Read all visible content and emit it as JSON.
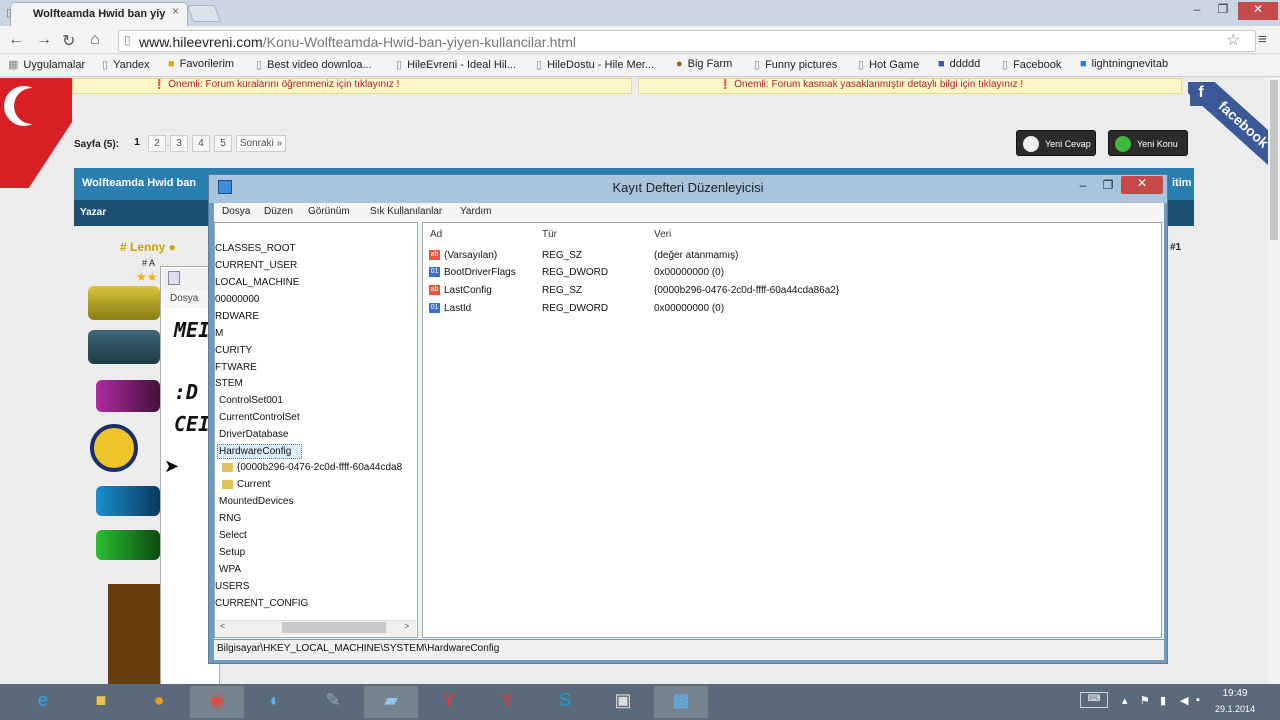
{
  "browser": {
    "tab_title": "Wolfteamda Hwid ban yiy",
    "tab_close": "×",
    "url_host": "www.hileevreni.com",
    "url_path": "/Konu-Wolfteamda-Hwid-ban-yiyen-kullancilar.html",
    "window_min": "–",
    "window_max": "❐",
    "window_close": "✕",
    "bookmarks": [
      "Uygulamalar",
      "Yandex",
      "Favorilerim",
      "Best video downloa...",
      "HileEvreni - Ideal Hil...",
      "HileDostu - Hile Mer...",
      "Big Farm",
      "Funny pictures",
      "Hot Game",
      "ddddd",
      "Facebook",
      "lightningnevitab"
    ]
  },
  "forum": {
    "notice_left": "❗ Önemli: Forum kuralarını öğrenmeniz için tıklayınız !",
    "notice_right": "❗ Önemli: Forum kasmak yasaklanmıştır detaylı bilgi için tıklayınız !",
    "facebook_ribbon": "facebook",
    "pager_label": "Sayfa (5):",
    "pages": [
      "1",
      "2",
      "3",
      "4",
      "5"
    ],
    "next": "Sonraki »",
    "reply_button": "Yeni Cevap",
    "new_topic_button": "Yeni Konu",
    "thread_title": "Wolfteamda Hwid ban",
    "thread_title_right": "itim",
    "author_header": "Yazar",
    "post_number": "#1",
    "username": "# Lenny ●",
    "user_status": "# A"
  },
  "notepad": {
    "menu": "Dosya",
    "lines": [
      "MEI",
      ":D",
      "CEI"
    ]
  },
  "regedit": {
    "title": "Kayıt Defteri Düzenleyicisi",
    "menu": [
      "Dosya",
      "Düzen",
      "Görünüm",
      "Sık Kullanılanlar",
      "Yardım"
    ],
    "tree": [
      "CLASSES_ROOT",
      "CURRENT_USER",
      "LOCAL_MACHINE",
      "00000000",
      "RDWARE",
      "M",
      "CURITY",
      "FTWARE",
      "STEM",
      "ControlSet001",
      "CurrentControlSet",
      "DriverDatabase",
      "HardwareConfig",
      "{0000b296-0476-2c0d-ffff-60a44cda8",
      "Current",
      "MountedDevices",
      "RNG",
      "Select",
      "Setup",
      "WPA",
      "USERS",
      "CURRENT_CONFIG"
    ],
    "columns": {
      "name": "Ad",
      "type": "Tür",
      "data": "Veri"
    },
    "values": [
      {
        "name": "(Varsayılan)",
        "type": "REG_SZ",
        "data": "(değer atanmamış)",
        "icon": "ab"
      },
      {
        "name": "BootDriverFlags",
        "type": "REG_DWORD",
        "data": "0x00000000 (0)",
        "icon": "dw"
      },
      {
        "name": "LastConfig",
        "type": "REG_SZ",
        "data": "{0000b296-0476-2c0d-ffff-60a44cda86a2}",
        "icon": "ab"
      },
      {
        "name": "LastId",
        "type": "REG_DWORD",
        "data": "0x00000000 (0)",
        "icon": "dw"
      }
    ],
    "status": "Bilgisayar\\HKEY_LOCAL_MACHINE\\SYSTEM\\HardwareConfig"
  },
  "taskbar": {
    "time": "19:49",
    "date": "29.1.2014"
  }
}
